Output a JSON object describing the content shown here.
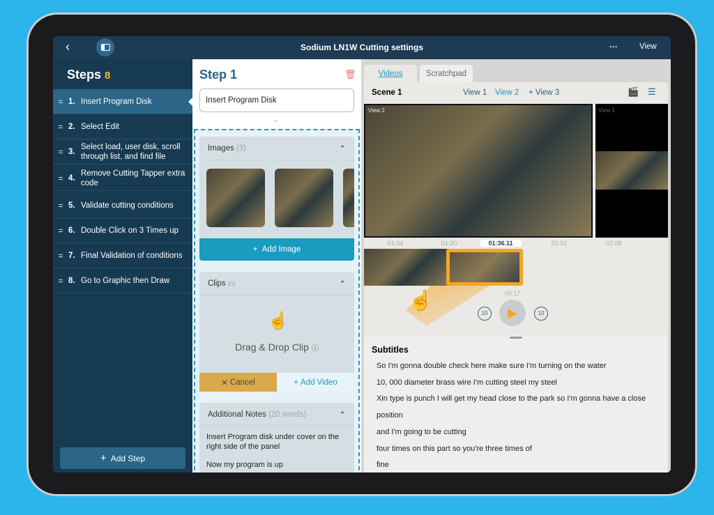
{
  "header": {
    "title": "Sodium LN1W Cutting settings",
    "more": "···",
    "view": "View"
  },
  "sidebar": {
    "title": "Steps",
    "count": "8",
    "add_step": "Add Step",
    "items": [
      {
        "n": "1.",
        "label": "Insert Program Disk"
      },
      {
        "n": "2.",
        "label": "Select Edit"
      },
      {
        "n": "3.",
        "label": "Select load, user disk, scroll through list, and find file"
      },
      {
        "n": "4.",
        "label": "Remove Cutting Tapper extra code"
      },
      {
        "n": "5.",
        "label": "Validate cutting conditions"
      },
      {
        "n": "6.",
        "label": "Double Click on 3 Times up"
      },
      {
        "n": "7.",
        "label": "Final Validation of conditions"
      },
      {
        "n": "8.",
        "label": "Go to Graphic then Draw"
      }
    ]
  },
  "step": {
    "title": "Step 1",
    "name_value": "Insert Program Disk",
    "images": {
      "label": "Images",
      "count": "(3)",
      "add": "Add Image"
    },
    "clips": {
      "label": "Clips",
      "count": "(0)",
      "drop": "Drag & Drop Clip",
      "cancel": "Cancel",
      "add": "Add Video"
    },
    "notes": {
      "label": "Additional Notes",
      "count": "(20 words)",
      "text1": "Insert Program disk under cover on the right side of the panel",
      "text2": "Now my program is up"
    }
  },
  "videos": {
    "tabs": [
      "Videos",
      "Scratchpad"
    ],
    "scene": "Scene 1",
    "views": [
      "View 1",
      "View 2",
      "View 3"
    ],
    "main_label": "View 2",
    "side_label": "View 1",
    "ticks": [
      "01:04",
      "01:20",
      "01:36.11",
      "01:52",
      "02:08"
    ],
    "clip_duration": "00:17",
    "skip": "10"
  },
  "subtitles": {
    "title": "Subtitles",
    "lines": [
      "So I'm gonna double check here make sure I'm turning on the water",
      "10, 000 diameter brass wire I'm cutting steel my steel",
      "Xin type is punch I will get my head close to the park so I'm gonna have a close",
      "position",
      "and I'm going to be cutting",
      "four times on this part so you're three times of",
      "fine"
    ]
  },
  "colors": {
    "accent": "#1a9bc0",
    "orange": "#f5a623",
    "navy": "#173a53"
  }
}
